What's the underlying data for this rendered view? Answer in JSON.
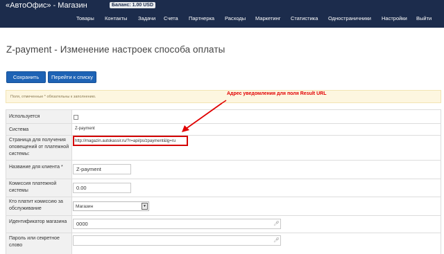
{
  "header": {
    "brand": "«АвтоОфис» - Магазин",
    "balance": "Баланс: 1.00 USD",
    "nav": [
      "Товары",
      "Контакты",
      "Задачи",
      "Счета",
      "Партнерка",
      "Расходы",
      "Маркетинг",
      "Статистика",
      "Одностраничники",
      "Настройки",
      "Выйти"
    ]
  },
  "page": {
    "title": "Z-payment - Изменение настроек способа оплаты"
  },
  "toolbar": {
    "save_label": "Сохранить",
    "list_label": "Перейти к списку"
  },
  "notice": {
    "text": "Поля, отмеченные * обязательны к заполнению.",
    "annotation": "Адрес уведомления для поля Result URL"
  },
  "form": {
    "used_label": "Используется",
    "used_checked": false,
    "system_label": "Система",
    "system_value": "Z-payment",
    "notify_label": "Страница для получения оповещений от платежной системы:",
    "notify_url": "http://magazin.autokassir.ru/?r=api/ps/zpayment&lg=ru",
    "client_name_label": "Название для клиента *",
    "client_name_value": "Z-payment",
    "commission_label": "Комиссия платежной системы",
    "commission_value": "0.00",
    "payer_label": "Кто платит комиссию за обслуживание",
    "payer_value": "Магазин",
    "shop_id_label": "Идентификатор магазина",
    "shop_id_value": "0000",
    "secret_label": "Пароль или секретное слово",
    "secret_value": ""
  },
  "colors": {
    "navbar": "#1c2c4c",
    "button": "#1e63b5",
    "highlight": "#d40000"
  }
}
